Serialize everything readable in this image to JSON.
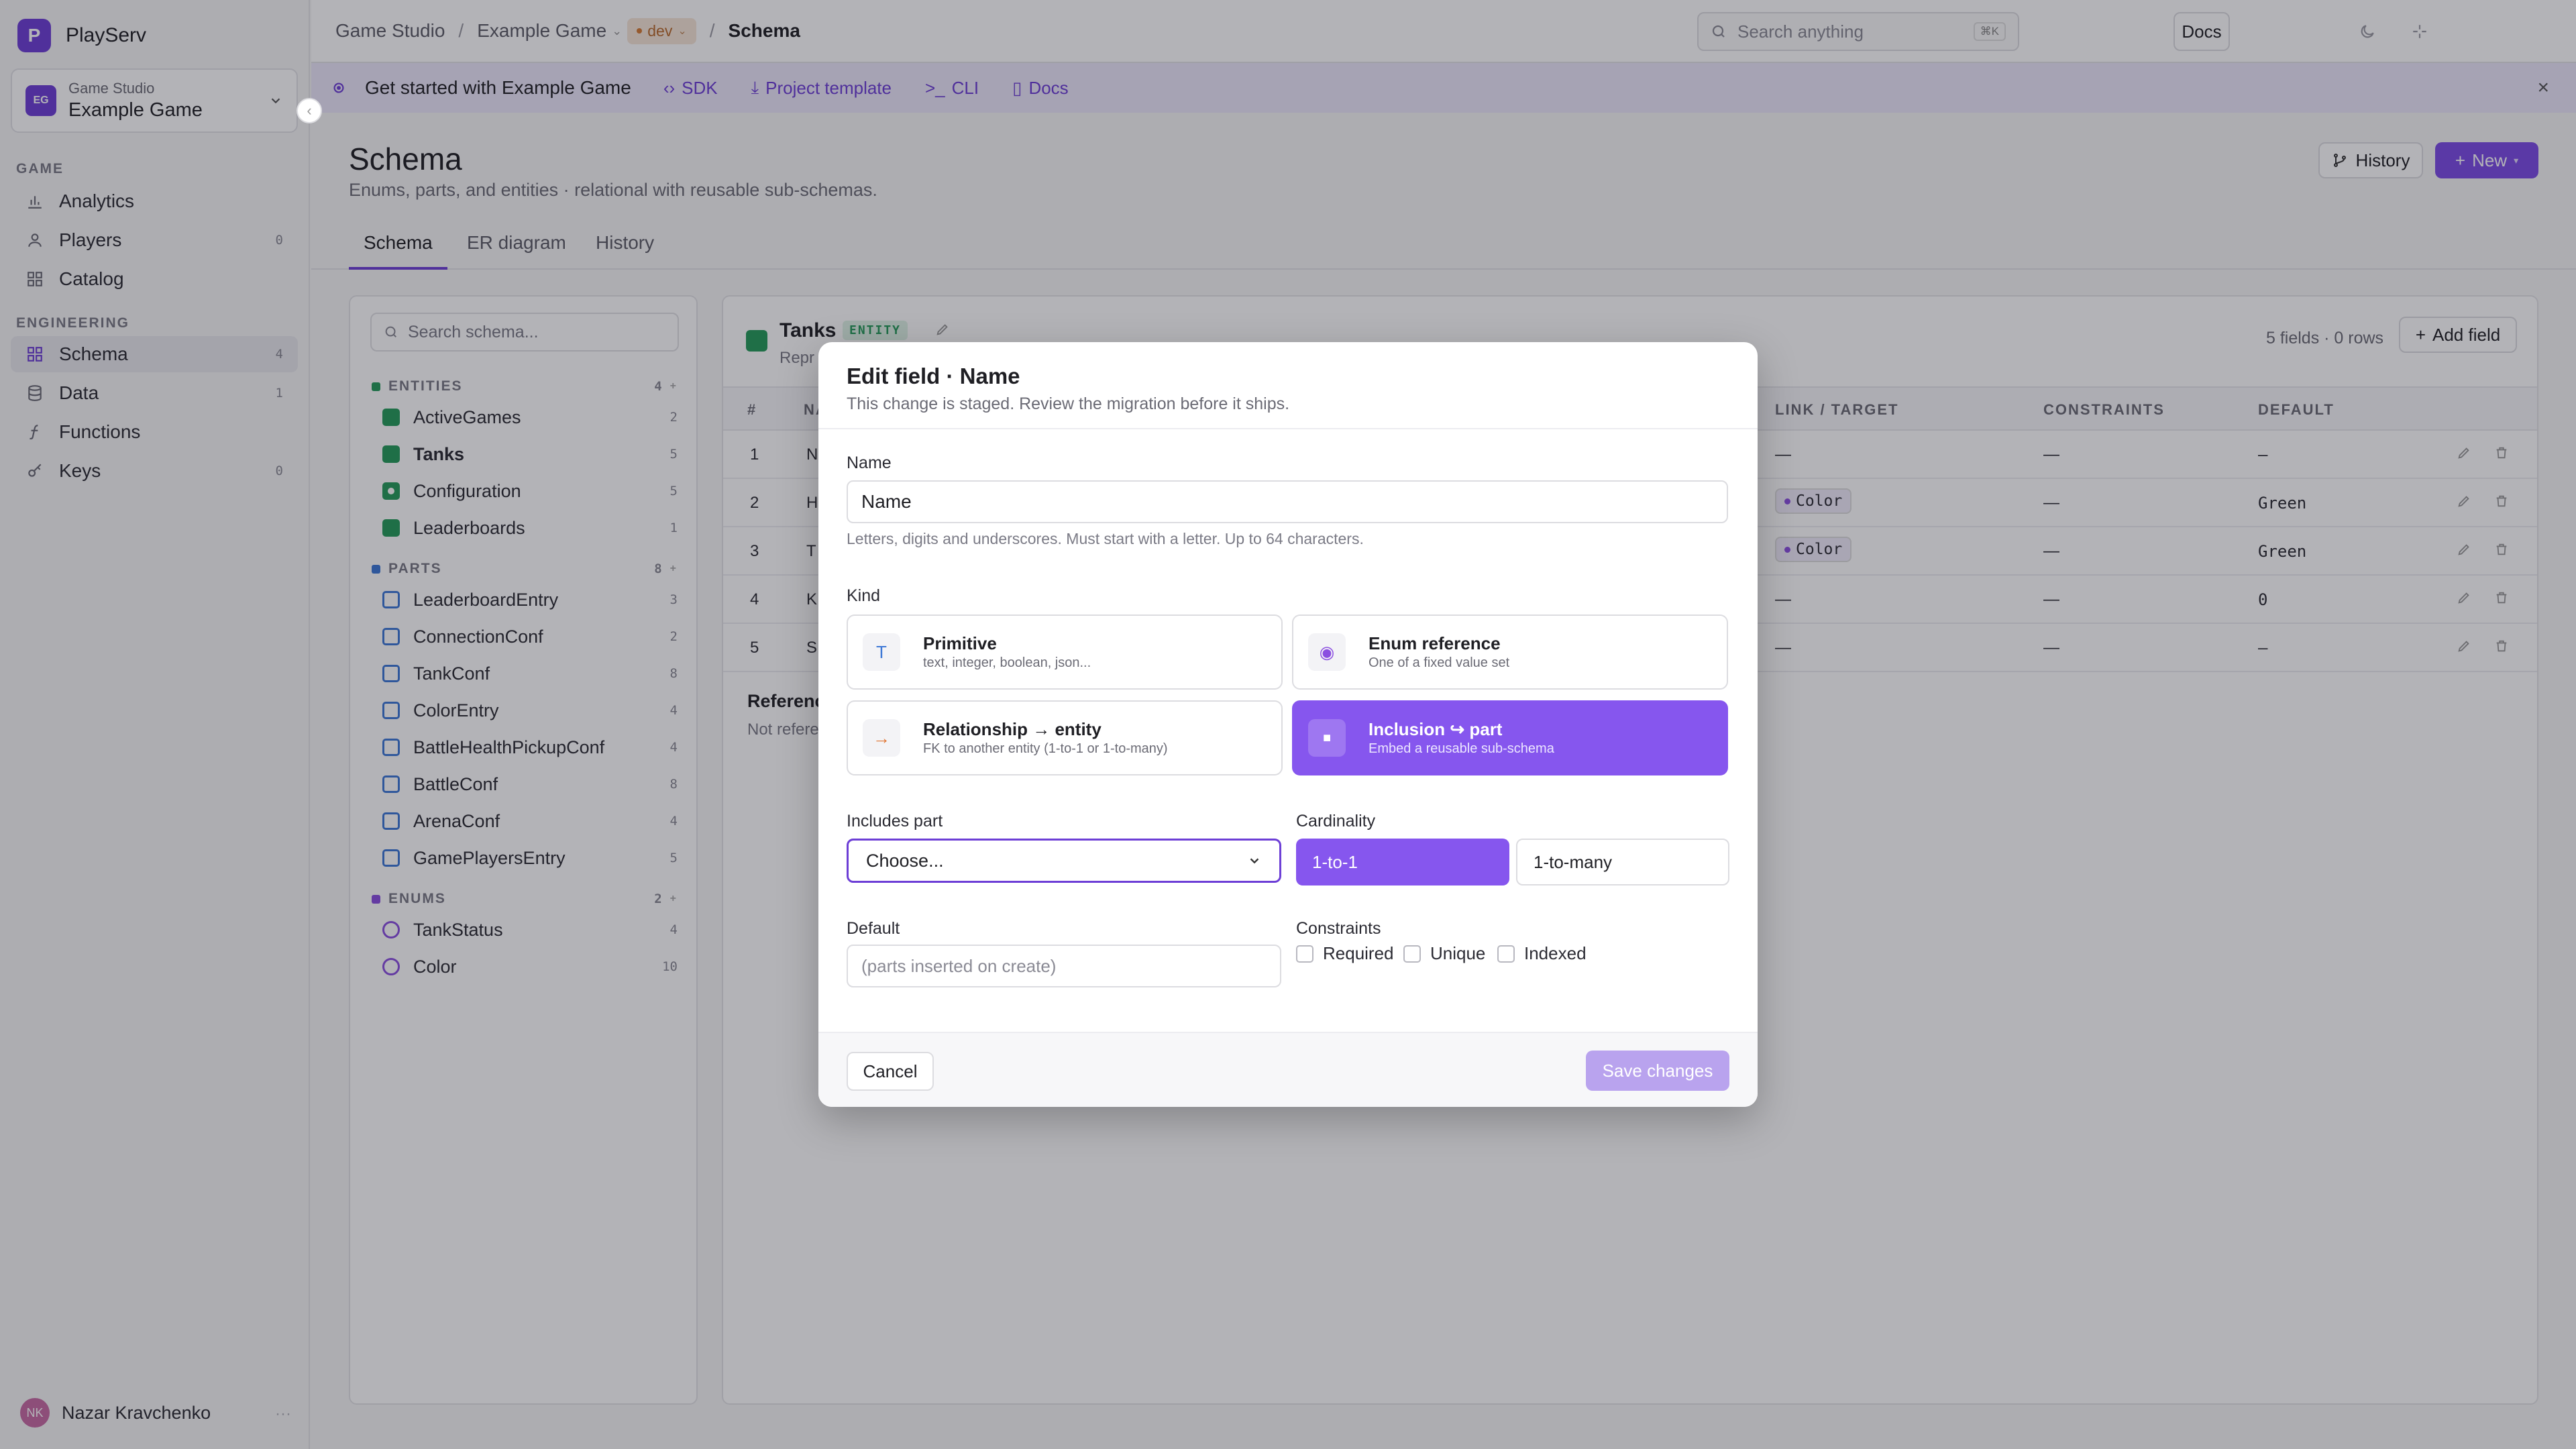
{
  "app": {
    "logo_letter": "P",
    "name": "PlayServ"
  },
  "project": {
    "avatar": "EG",
    "org": "Game Studio",
    "name": "Example Game"
  },
  "nav": {
    "game_section": "GAME",
    "game_items": [
      {
        "label": "Analytics",
        "count": ""
      },
      {
        "label": "Players",
        "count": "0"
      },
      {
        "label": "Catalog",
        "count": ""
      }
    ],
    "engineering_section": "ENGINEERING",
    "engineering_items": [
      {
        "label": "Schema",
        "count": "4"
      },
      {
        "label": "Data",
        "count": "1"
      },
      {
        "label": "Functions",
        "count": ""
      },
      {
        "label": "Keys",
        "count": "0"
      }
    ]
  },
  "user": {
    "initials": "NK",
    "name": "Nazar Kravchenko"
  },
  "topbar": {
    "breadcrumb": [
      "Game Studio",
      "Example Game",
      "Schema"
    ],
    "env": "dev",
    "search_placeholder": "Search anything",
    "search_shortcut": "⌘K",
    "docs": "Docs"
  },
  "banner": {
    "title": "Get started with Example Game",
    "links": [
      "SDK",
      "Project template",
      "CLI",
      "Docs"
    ]
  },
  "page": {
    "title": "Schema",
    "subtitle": "Enums, parts, and entities · relational with reusable sub-schemas.",
    "history_btn": "History",
    "new_btn": "New"
  },
  "tabs": [
    "Schema",
    "ER diagram",
    "History"
  ],
  "schema_panel": {
    "search_placeholder": "Search schema...",
    "entities_label": "ENTITIES",
    "entities_count": "4",
    "entities": [
      {
        "name": "ActiveGames",
        "count": "2"
      },
      {
        "name": "Tanks",
        "count": "5"
      },
      {
        "name": "Configuration",
        "count": "5"
      },
      {
        "name": "Leaderboards",
        "count": "1"
      }
    ],
    "parts_label": "PARTS",
    "parts_count": "8",
    "parts": [
      {
        "name": "LeaderboardEntry",
        "count": "3"
      },
      {
        "name": "ConnectionConf",
        "count": "2"
      },
      {
        "name": "TankConf",
        "count": "8"
      },
      {
        "name": "ColorEntry",
        "count": "4"
      },
      {
        "name": "BattleHealthPickupConf",
        "count": "4"
      },
      {
        "name": "BattleConf",
        "count": "8"
      },
      {
        "name": "ArenaConf",
        "count": "4"
      },
      {
        "name": "GamePlayersEntry",
        "count": "5"
      }
    ],
    "enums_label": "ENUMS",
    "enums_count": "2",
    "enums": [
      {
        "name": "TankStatus",
        "count": "4"
      },
      {
        "name": "Color",
        "count": "10"
      }
    ]
  },
  "entity": {
    "name": "Tanks",
    "badge": "ENTITY",
    "desc": "Repr",
    "meta": "5 fields · 0 rows",
    "add_field": "Add field",
    "columns": {
      "num": "#",
      "name": "NA",
      "link": "LINK / TARGET",
      "constraints": "CONSTRAINTS",
      "default": "DEFAULT"
    },
    "rows": [
      {
        "num": "1",
        "name": "N",
        "link": "—",
        "constraints": "—",
        "default": "—"
      },
      {
        "num": "2",
        "name": "H",
        "link": "Color",
        "constraints": "—",
        "default": "Green"
      },
      {
        "num": "3",
        "name": "T",
        "link": "Color",
        "constraints": "—",
        "default": "Green"
      },
      {
        "num": "4",
        "name": "K",
        "link": "—",
        "constraints": "—",
        "default": "0"
      },
      {
        "num": "5",
        "name": "S",
        "link": "—",
        "constraints": "—",
        "default": "—"
      }
    ],
    "references_title": "Referenc",
    "references_sub": "Not refere"
  },
  "modal": {
    "title": "Edit field · Name",
    "subtitle": "This change is staged. Review the migration before it ships.",
    "name_label": "Name",
    "name_value": "Name",
    "name_hint": "Letters, digits and underscores. Must start with a letter. Up to 64 characters.",
    "kind_label": "Kind",
    "kinds": [
      {
        "title": "Primitive",
        "desc": "text, integer, boolean, json...",
        "icon": "T"
      },
      {
        "title": "Enum reference",
        "desc": "One of a fixed value set",
        "icon": "◉"
      },
      {
        "title": "Relationship → entity",
        "desc": "FK to another entity (1-to-1 or 1-to-many)",
        "icon": "→"
      },
      {
        "title": "Inclusion ↪ part",
        "desc": "Embed a reusable sub-schema",
        "icon": "■"
      }
    ],
    "includes_label": "Includes part",
    "includes_value": "Choose...",
    "cardinality_label": "Cardinality",
    "cardinality_options": [
      "1-to-1",
      "1-to-many"
    ],
    "default_label": "Default",
    "default_placeholder": "(parts inserted on create)",
    "constraints_label": "Constraints",
    "constraints": [
      "Required",
      "Unique",
      "Indexed"
    ],
    "cancel": "Cancel",
    "save": "Save changes"
  },
  "colors": {
    "accent": "#7c4ce6",
    "entity": "#259b5a",
    "part": "#3d78d6",
    "enum": "#8b4fe0"
  }
}
